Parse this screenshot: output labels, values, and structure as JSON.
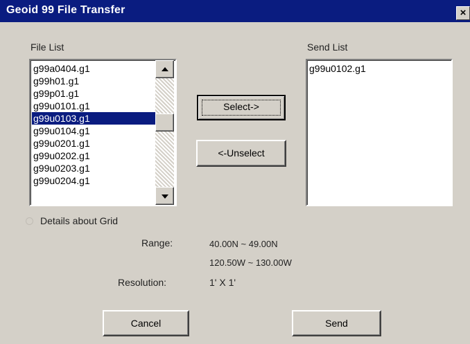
{
  "window": {
    "title": "Geoid 99 File Transfer",
    "close_label": "×"
  },
  "file_list": {
    "label": "File List",
    "items": [
      "g99a0404.g1",
      "g99h01.g1",
      "g99p01.g1",
      "g99u0101.g1",
      "g99u0103.g1",
      "g99u0104.g1",
      "g99u0201.g1",
      "g99u0202.g1",
      "g99u0203.g1",
      "g99u0204.g1"
    ],
    "selected_item": "g99u0103.g1"
  },
  "send_list": {
    "label": "Send List",
    "items": [
      "g99u0102.g1"
    ]
  },
  "buttons": {
    "select": "Select->",
    "unselect": "<-Unselect",
    "cancel": "Cancel",
    "send": "Send"
  },
  "details": {
    "label": "Details about Grid",
    "range_label": "Range:",
    "range_lat": "40.00N ~ 49.00N",
    "range_lon": "120.50W ~ 130.00W",
    "resolution_label": "Resolution:",
    "resolution_value": "1' X 1'"
  },
  "colors": {
    "titlebar": "#0a1c80",
    "dialog_bg": "#d4d0c8",
    "selection": "#0a1c80"
  }
}
